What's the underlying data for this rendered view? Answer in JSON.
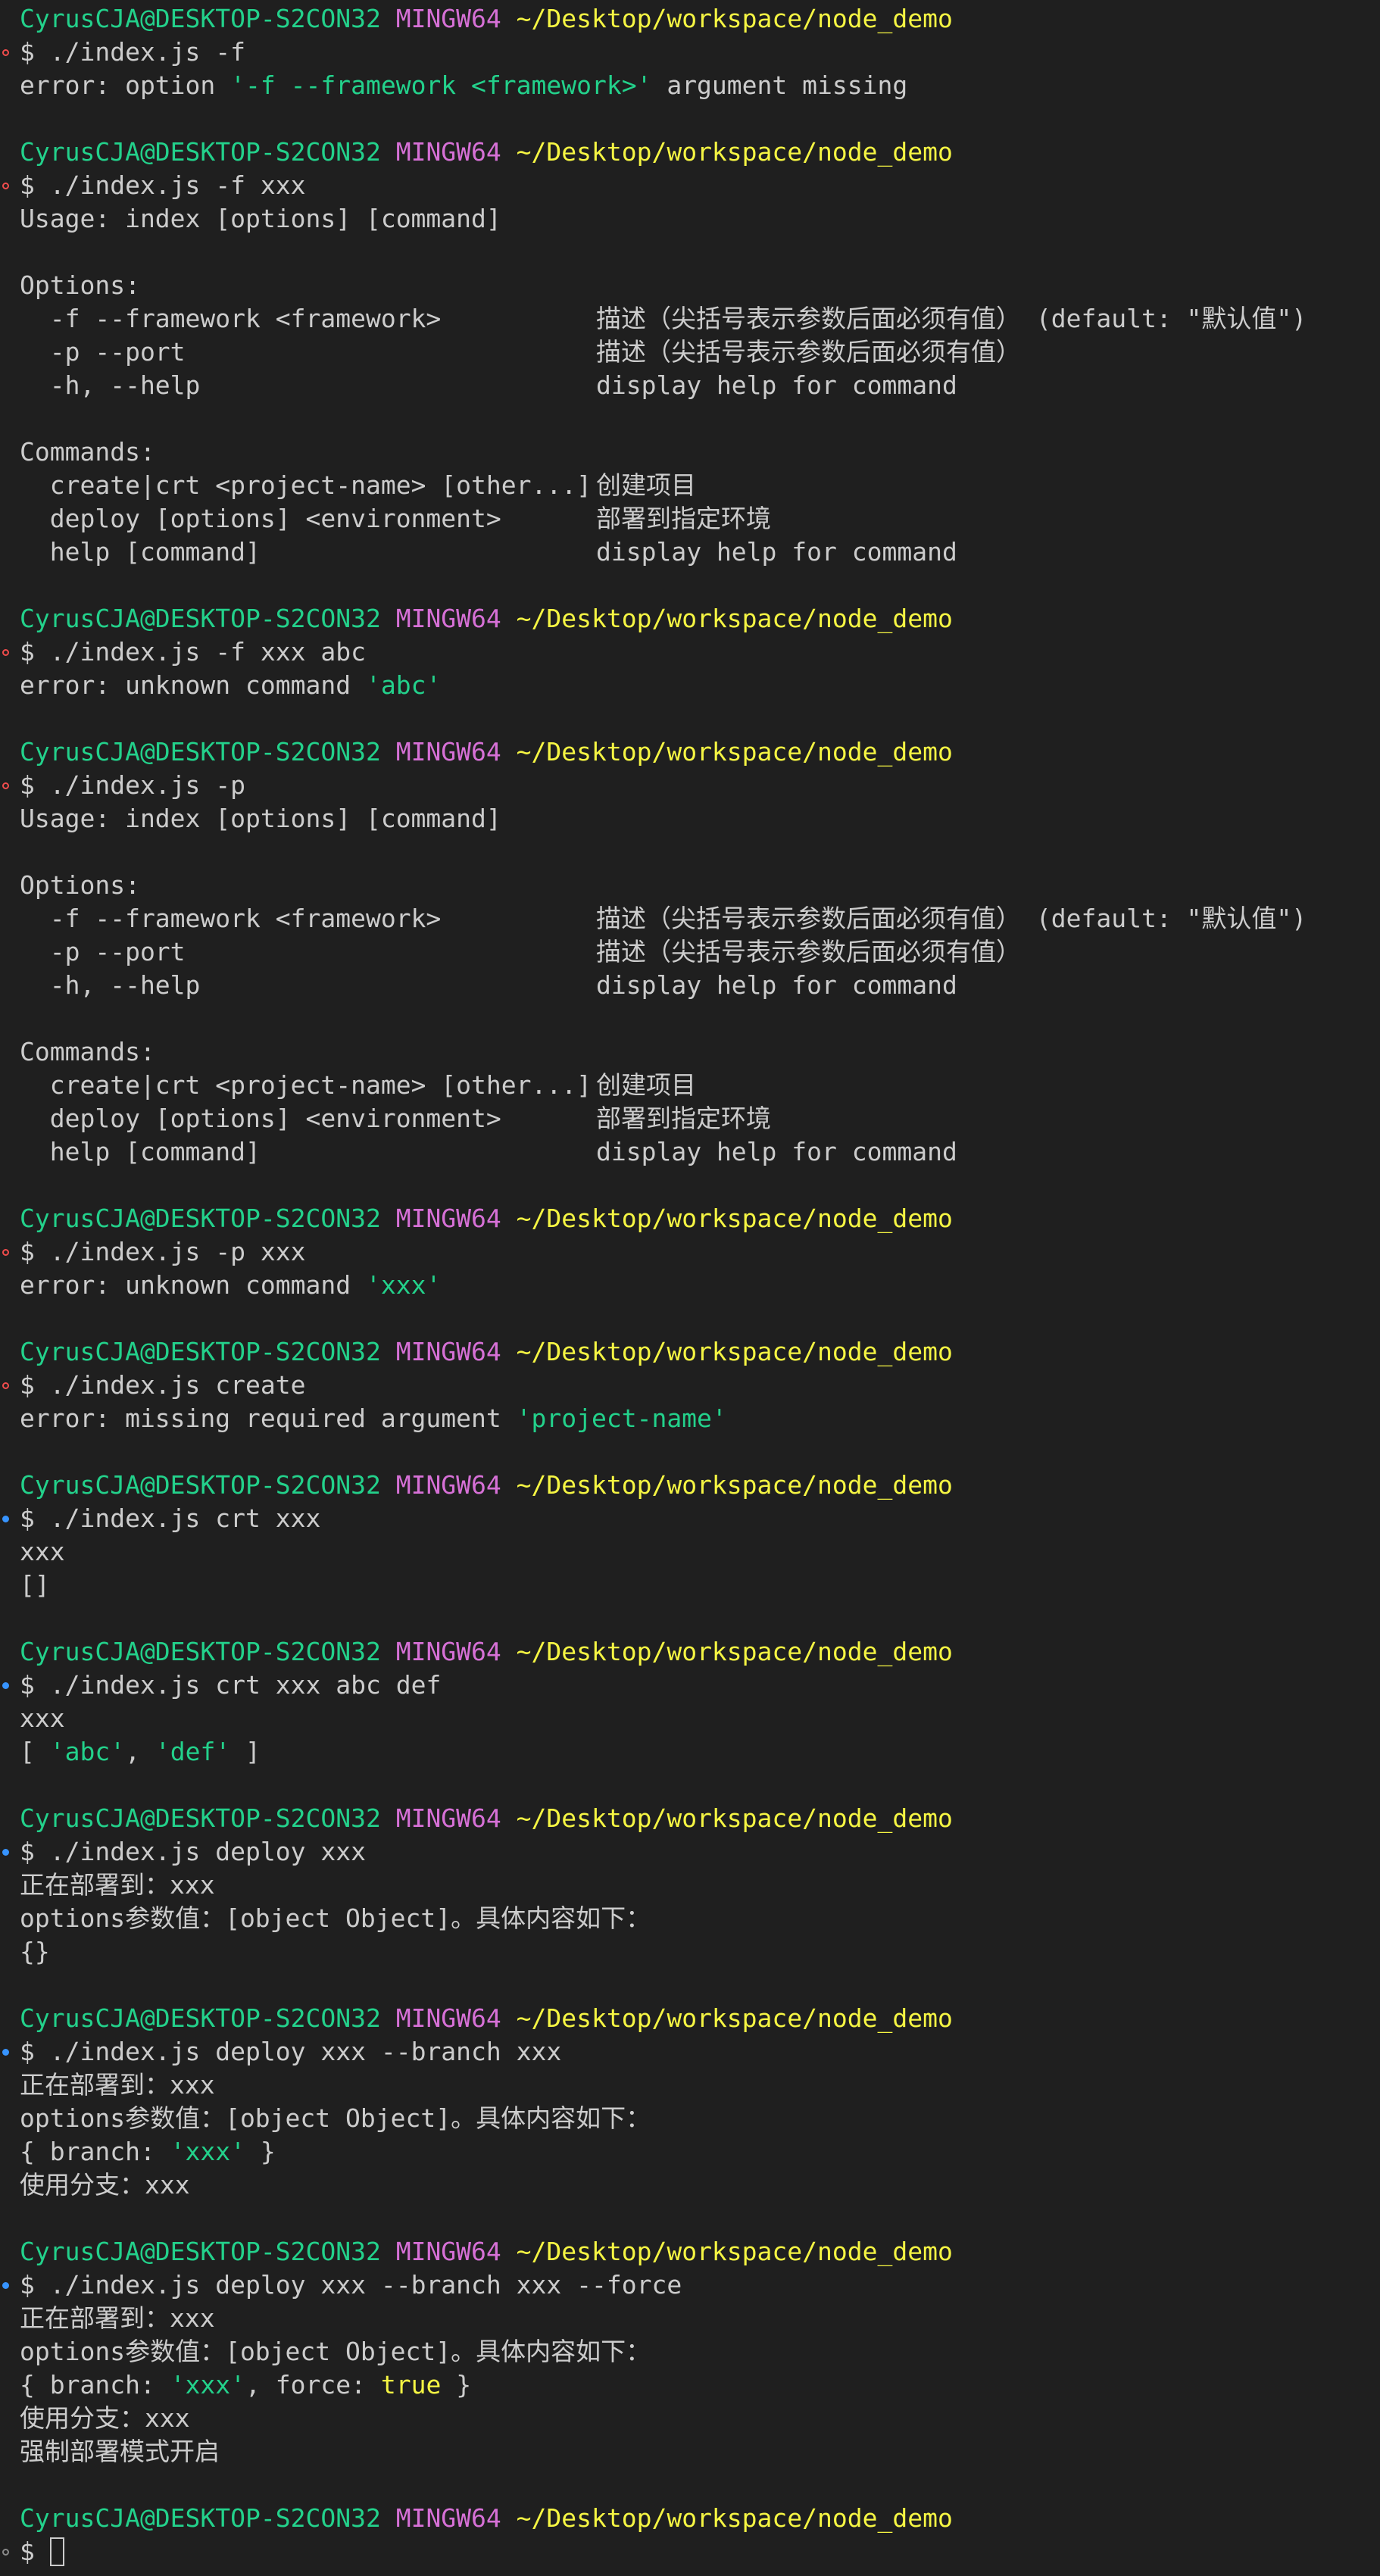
{
  "prompt": {
    "user": "CyrusCJA@DESKTOP-S2CON32",
    "system": "MINGW64",
    "path": "~/Desktop/workspace/node_demo",
    "symbol": "$"
  },
  "help": {
    "usage": "Usage: index [options] [command]",
    "options_header": "Options:",
    "options": [
      {
        "flag": "-f --framework <framework>",
        "desc": "描述（尖括号表示参数后面必须有值） (default: \"默认值\")"
      },
      {
        "flag": "-p --port",
        "desc": "描述（尖括号表示参数后面必须有值）"
      },
      {
        "flag": "-h, --help",
        "desc": "display help for command"
      }
    ],
    "commands_header": "Commands:",
    "commands": [
      {
        "name": "create|crt <project-name> [other...]",
        "desc": "创建项目"
      },
      {
        "name": "deploy [options] <environment>",
        "desc": "部署到指定环境"
      },
      {
        "name": "help [command]",
        "desc": "display help for command"
      }
    ]
  },
  "blocks": [
    {
      "status": "error",
      "command": "./index.js -f",
      "output": [
        "error: option '-f --framework <framework>' argument missing"
      ]
    },
    {
      "status": "error",
      "command": "./index.js -f xxx",
      "show_help": true
    },
    {
      "status": "error",
      "command": "./index.js -f xxx abc",
      "output": [
        "error: unknown command 'abc'"
      ]
    },
    {
      "status": "error",
      "command": "./index.js -p",
      "show_help": true
    },
    {
      "status": "error",
      "command": "./index.js -p xxx",
      "output": [
        "error: unknown command 'xxx'"
      ]
    },
    {
      "status": "error",
      "command": "./index.js create",
      "output": [
        "error: missing required argument 'project-name'"
      ]
    },
    {
      "status": "success",
      "command": "./index.js crt xxx",
      "output": [
        "xxx",
        "[]"
      ]
    },
    {
      "status": "success",
      "command": "./index.js crt xxx abc def",
      "output": [
        "xxx",
        "[ 'abc', 'def' ]"
      ]
    },
    {
      "status": "success",
      "command": "./index.js deploy xxx",
      "output": [
        "正在部署到：xxx",
        "options参数值：[object Object]。具体内容如下：",
        "{}"
      ]
    },
    {
      "status": "success",
      "command": "./index.js deploy xxx --branch xxx",
      "output": [
        "正在部署到：xxx",
        "options参数值：[object Object]。具体内容如下：",
        "{ branch: 'xxx' }",
        "使用分支：xxx"
      ]
    },
    {
      "status": "success",
      "command": "./index.js deploy xxx --branch xxx --force",
      "output": [
        "正在部署到：xxx",
        "options参数值：[object Object]。具体内容如下：",
        "{ branch: 'xxx', force: true }",
        "使用分支：xxx",
        "强制部署模式开启"
      ]
    },
    {
      "status": "idle",
      "command": "",
      "current_input": true
    }
  ],
  "colors": {
    "background": "#1f1f1f",
    "foreground": "#cccccc",
    "user": "#23d18b",
    "system": "#d670d6",
    "path": "#f5f543",
    "string": "#23d18b",
    "keyword": "#f5f543",
    "error_marker": "#f14c4c",
    "success_marker": "#3794ff"
  }
}
